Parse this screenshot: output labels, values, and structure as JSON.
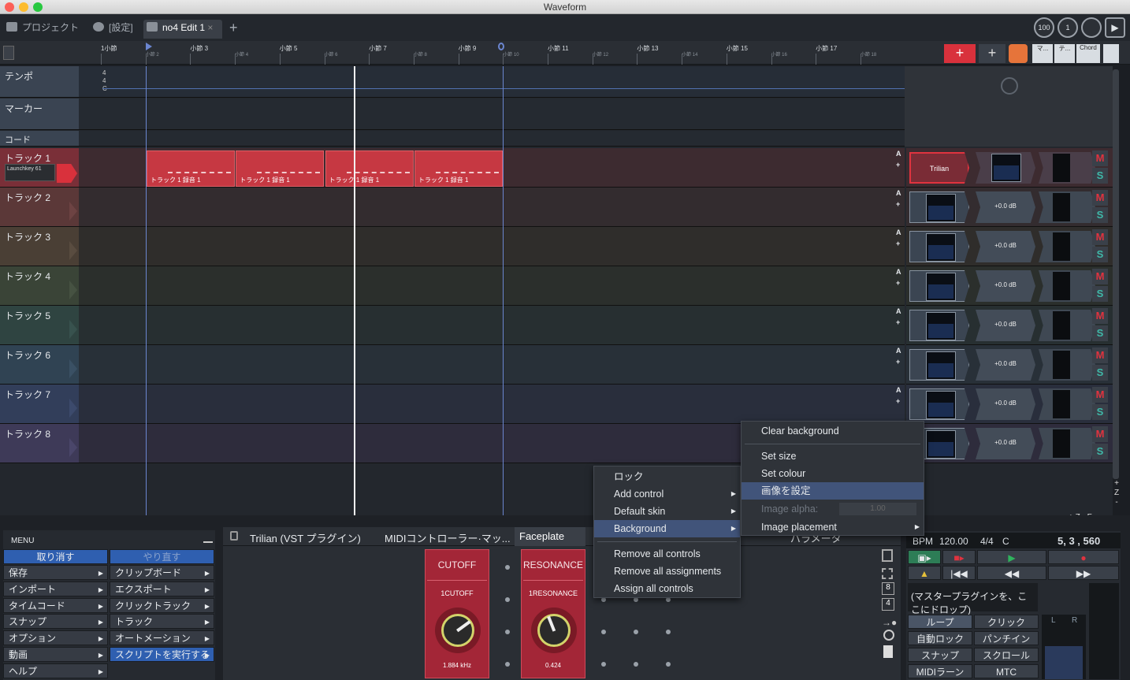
{
  "window": {
    "title": "Waveform"
  },
  "tabs": {
    "project": "プロジェクト",
    "settings": "[設定]",
    "edit": "no4 Edit 1",
    "close": "×",
    "add": "+"
  },
  "top_controls": {
    "tempo_knob": "100",
    "meter_knob": "1"
  },
  "ruler": {
    "bars": [
      "1小節",
      "小節 3",
      "小節 5",
      "小節 7",
      "小節 9",
      "小節 11",
      "小節 13",
      "小節 15",
      "小節 17"
    ],
    "sub_bars": [
      "小節 2",
      "小節 4",
      "小節 6",
      "小節 8",
      "小節 10",
      "小節 12",
      "小節 14",
      "小節 16",
      "小節 18"
    ]
  },
  "right_header": {
    "add_red": "+",
    "add": "+",
    "b1": "マ...",
    "b2": "テ...",
    "b3": "Chord"
  },
  "global_tracks": {
    "tempo": "テンポ",
    "marker": "マーカー",
    "chord": "コード",
    "timesig": [
      "4",
      "4",
      "C"
    ]
  },
  "tracks": [
    {
      "name": "トラック 1",
      "input": "Launchkey 61",
      "plugin": "Trilian",
      "armed": true
    },
    {
      "name": "トラック 2",
      "volume": "+0.0 dB"
    },
    {
      "name": "トラック 3",
      "volume": "+0.0 dB"
    },
    {
      "name": "トラック 4",
      "volume": "+0.0 dB"
    },
    {
      "name": "トラック 5",
      "volume": "+0.0 dB"
    },
    {
      "name": "トラック 6",
      "volume": "+0.0 dB"
    },
    {
      "name": "トラック 7",
      "volume": "+0.0 dB"
    },
    {
      "name": "トラック 8",
      "volume": "+0.0 dB"
    }
  ],
  "clips": [
    "トラック 1 録音 1",
    "トラック 1 録音 1",
    "トラック 1 録音 1",
    "トラック 1 録音 1"
  ],
  "channel_labels": {
    "a": "A",
    "plus": "+",
    "m": "M",
    "s": "S"
  },
  "context_menu_1": {
    "items": [
      "ロック",
      "Add control",
      "Default skin",
      "Background",
      "Remove all controls",
      "Remove all assignments",
      "Assign all controls"
    ],
    "highlighted": "Background"
  },
  "context_menu_2": {
    "items": [
      "Clear background",
      "Set size",
      "Set colour",
      "画像を設定",
      "Image alpha:",
      "Image placement"
    ],
    "image_alpha_value": "1.00",
    "highlighted": "画像を設定"
  },
  "zoom_labels": {
    "plus": "+",
    "z": "Z",
    "minus": "-",
    "f": "F",
    "hint": "+ Z - F"
  },
  "menu": {
    "title": "MENU",
    "undo": "取り消す",
    "redo": "やり直す",
    "left": [
      "保存",
      "インポート",
      "タイムコード",
      "スナップ",
      "オプション",
      "動画",
      "ヘルプ"
    ],
    "right": [
      "クリップボード",
      "エクスポート",
      "クリックトラック",
      "トラック",
      "オートメーション",
      "スクリプトを実行する"
    ]
  },
  "plugin_panel": {
    "tab1": "Trilian (VST プラグイン)",
    "tab2": "MIDIコントローラー·マッ...",
    "tab3": "Faceplate",
    "tab4": "パラメータ",
    "knobs": [
      {
        "title": "CUTOFF",
        "label": "1CUTOFF",
        "value": "1.884 kHz",
        "level": 0.7
      },
      {
        "title": "RESONANCE",
        "label": "1RESONANCE",
        "value": "0.424",
        "level": 0.42
      }
    ],
    "side_numbers": [
      "8",
      "4"
    ]
  },
  "transport": {
    "bpm_label": "BPM",
    "bpm": "120.00",
    "timesig": "4/4",
    "key": "C",
    "position": "5, 3 , 560",
    "drop_text": "(マスタープラグインを、ここにドロップ)",
    "buttons": [
      "ループ",
      "クリック",
      "自動ロック",
      "パンチイン",
      "スナップ",
      "スクロール",
      "MIDIラーン",
      "MTC"
    ],
    "lr": [
      "L",
      "R"
    ]
  },
  "colors": {
    "accent": "#2f5fb0",
    "clip": "#c63842",
    "mute": "#e0333f",
    "solo": "#3fb8a8"
  }
}
